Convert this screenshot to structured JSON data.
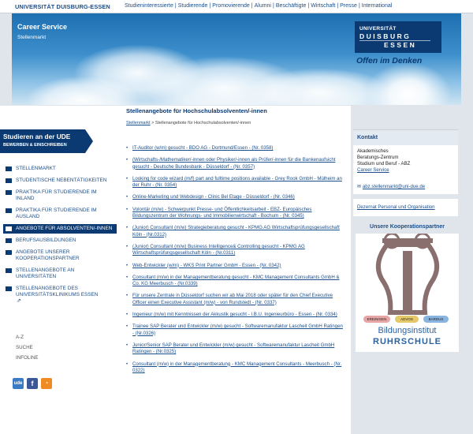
{
  "header": {
    "university_name": "UNIVERSITÄT DUISBURG-ESSEN",
    "nav": [
      "Studieninteressierte",
      "Studierende",
      "Promovierende",
      "Alumni",
      "Beschäftigte",
      "Wirtschaft",
      "Presse",
      "International"
    ],
    "section_title": "Career Service",
    "section_subtitle": "Stellenmarkt",
    "logo_line1": "UNIVERSITÄT",
    "logo_line2": "DUISBURG",
    "logo_line3": "ESSEN",
    "slogan": "Offen im Denken"
  },
  "sidebar": {
    "title": "Studieren an der UDE",
    "subtitle": "BEWERBEN & EINSCHREIBEN",
    "items": [
      {
        "label": "STELLENMARKT",
        "active": false
      },
      {
        "label": "STUDENTISCHE NEBENTÄTIGKEITEN",
        "active": false
      },
      {
        "label": "PRAKTIKA FÜR STUDIERENDE IM INLAND",
        "active": false
      },
      {
        "label": "PRAKTIKA FÜR STUDIERENDE IM AUSLAND",
        "active": false
      },
      {
        "label": "ANGEBOTE FÜR ABSOLVENTEN/-INNEN",
        "active": true
      },
      {
        "label": "BERUFSAUSBILDUNGEN",
        "active": false
      },
      {
        "label": "ANGEBOTE UNSERER KOOPERATIONSPARTNER",
        "active": false
      },
      {
        "label": "STELLENANGEBOTE AN UNIVERSITÄTEN",
        "active": false
      },
      {
        "label": "STELLENANGEBOTE DES UNIVERSITÄTSKLINIKUMS ESSEN",
        "active": false
      }
    ],
    "links": [
      "A-Z",
      "SUCHE",
      "INFOLINE"
    ],
    "social": [
      "ude-icon",
      "facebook-icon",
      "rss-icon"
    ]
  },
  "main": {
    "title": "Stellenangebote für Hochschulabsolventen/-innen",
    "breadcrumb_link": "Stellenmarkt",
    "breadcrumb_sep": ">",
    "breadcrumb_current": "Stellenangebote für Hochschulabsolventen/-innen",
    "jobs": [
      "IT-Auditor (w/m) gesucht - BDO AG - Dortmund/Essen - (Nr. 0358)",
      "(Wirtschafts-/Mathematiker/-innen oder Physiker/-innen als Prüfer/-innen für die Bankenaufsicht gesucht - Deutsche Bundesbank - Düsseldorf - (Nr. 0357)",
      "Looking for code wizard (m/f) part and fulltime positions available - Grey Rook GmbH - Mülheim an der Ruhr - (Nr. 0354)",
      "Online-Marketing und Webdesign - Clinic Bel Etage - Düsseldorf - (Nr. 0346)",
      "Volontär (m/w) - Schwerpunkt Presse- und Öffentlichkeitsarbeit - EBZ- Europäisches Bildungszentrum der Wohnungs- und Immobilienwirtschaft - Bochum - (Nr. 0345)",
      "(Junior) Consultant (m/w) Strategieberatung gesucht - KPMG AG Wirtschaftsprüfungsgesellschaft Köln - (Nr.0312)",
      "(Junior) Consultant (m/w) Business Intelligence& Controlling gesucht - KPMG AG Wirtschaftsprüfungsgesellschaft Köln - (Nr.0311)",
      "Web-Entwickler (w/m) - WKS Print Partner GmbH - Essen - (Nr. 0342)",
      "Consultant (m/w) in der Managementberatung gesucht - KMC Management Consultants GmbH & Co. KG Meerbusch - (Nr.0339)",
      "Für unsere Zentrale in Düsseldorf suchen wir ab Mai 2018 oder später für den Chief Executive Officer einen Executive Assistant (m/w) - von Rundstedt - (Nr. 0337)",
      "Ingenieur (m/w) mit Kenntnissen der Akkustik gesucht - I.B.U. Ingenieurbüro - Essen - (Nr. 0334)",
      "Trainee SAP Berater und Entwickler (m/w) gesucht - Softwaremanufaktur Lascheit GmbH Ratingen - (Nr.0326)",
      "Junior/Senior SAP Berater und Entwickler (m/w) gesucht - Softwaremanufaktur Lascheit GmbH Ratingen - (Nr.0325)",
      "Consultant (m/w) in der Managementberatung - KMC Management Consultants - Meerbusch - (Nr. 0322)"
    ]
  },
  "right": {
    "contact_title": "Kontakt",
    "contact_lines": [
      "Akademisches",
      "Beratungs-Zentrum",
      "Studium und Beruf - ABZ"
    ],
    "contact_link": "Career Service",
    "contact_email": "abz.stellenmarkt@uni-due.de",
    "dezernat_link": "Dezernat Personal und Organisation",
    "partner_title": "Unsere Kooperationspartner",
    "partner_name_line1": "Bildungsinstitut",
    "partner_name_line2": "RUHRSCHULE",
    "partner_chips": [
      "EREINIGEN",
      "ADVOS",
      "BARDUS"
    ]
  },
  "colors": {
    "brand_dark": "#0b3a72",
    "link": "#1a4e8c",
    "page_bg": "#dfe5ea"
  }
}
